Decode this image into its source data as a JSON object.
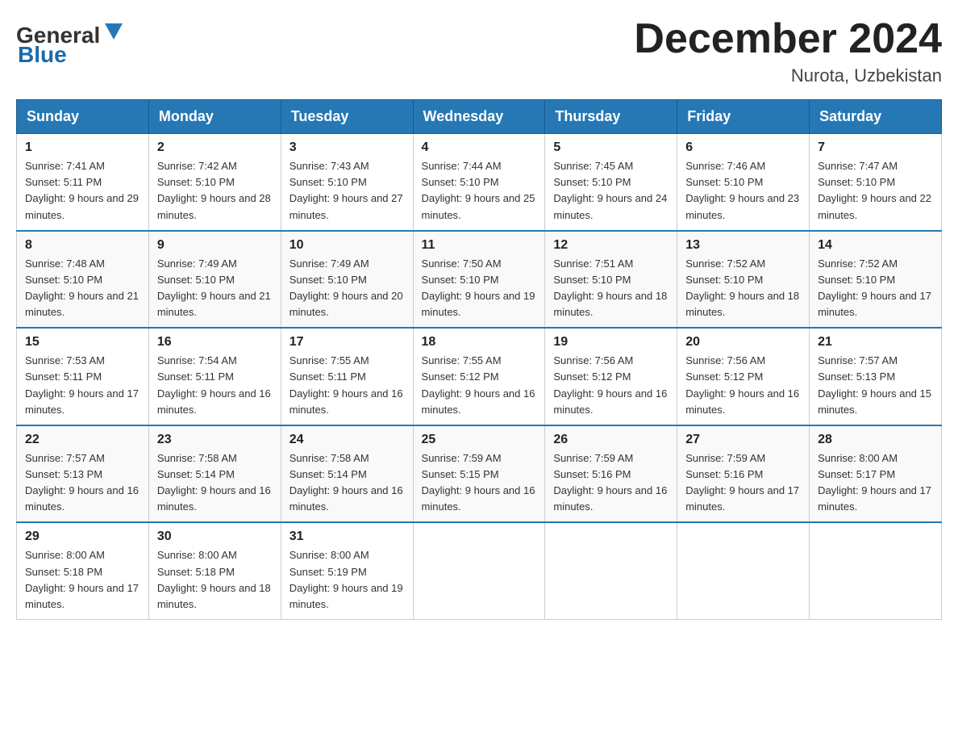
{
  "header": {
    "logo_general": "General",
    "logo_blue": "Blue",
    "month_title": "December 2024",
    "location": "Nurota, Uzbekistan"
  },
  "weekdays": [
    "Sunday",
    "Monday",
    "Tuesday",
    "Wednesday",
    "Thursday",
    "Friday",
    "Saturday"
  ],
  "weeks": [
    [
      {
        "day": "1",
        "sunrise": "7:41 AM",
        "sunset": "5:11 PM",
        "daylight": "9 hours and 29 minutes."
      },
      {
        "day": "2",
        "sunrise": "7:42 AM",
        "sunset": "5:10 PM",
        "daylight": "9 hours and 28 minutes."
      },
      {
        "day": "3",
        "sunrise": "7:43 AM",
        "sunset": "5:10 PM",
        "daylight": "9 hours and 27 minutes."
      },
      {
        "day": "4",
        "sunrise": "7:44 AM",
        "sunset": "5:10 PM",
        "daylight": "9 hours and 25 minutes."
      },
      {
        "day": "5",
        "sunrise": "7:45 AM",
        "sunset": "5:10 PM",
        "daylight": "9 hours and 24 minutes."
      },
      {
        "day": "6",
        "sunrise": "7:46 AM",
        "sunset": "5:10 PM",
        "daylight": "9 hours and 23 minutes."
      },
      {
        "day": "7",
        "sunrise": "7:47 AM",
        "sunset": "5:10 PM",
        "daylight": "9 hours and 22 minutes."
      }
    ],
    [
      {
        "day": "8",
        "sunrise": "7:48 AM",
        "sunset": "5:10 PM",
        "daylight": "9 hours and 21 minutes."
      },
      {
        "day": "9",
        "sunrise": "7:49 AM",
        "sunset": "5:10 PM",
        "daylight": "9 hours and 21 minutes."
      },
      {
        "day": "10",
        "sunrise": "7:49 AM",
        "sunset": "5:10 PM",
        "daylight": "9 hours and 20 minutes."
      },
      {
        "day": "11",
        "sunrise": "7:50 AM",
        "sunset": "5:10 PM",
        "daylight": "9 hours and 19 minutes."
      },
      {
        "day": "12",
        "sunrise": "7:51 AM",
        "sunset": "5:10 PM",
        "daylight": "9 hours and 18 minutes."
      },
      {
        "day": "13",
        "sunrise": "7:52 AM",
        "sunset": "5:10 PM",
        "daylight": "9 hours and 18 minutes."
      },
      {
        "day": "14",
        "sunrise": "7:52 AM",
        "sunset": "5:10 PM",
        "daylight": "9 hours and 17 minutes."
      }
    ],
    [
      {
        "day": "15",
        "sunrise": "7:53 AM",
        "sunset": "5:11 PM",
        "daylight": "9 hours and 17 minutes."
      },
      {
        "day": "16",
        "sunrise": "7:54 AM",
        "sunset": "5:11 PM",
        "daylight": "9 hours and 16 minutes."
      },
      {
        "day": "17",
        "sunrise": "7:55 AM",
        "sunset": "5:11 PM",
        "daylight": "9 hours and 16 minutes."
      },
      {
        "day": "18",
        "sunrise": "7:55 AM",
        "sunset": "5:12 PM",
        "daylight": "9 hours and 16 minutes."
      },
      {
        "day": "19",
        "sunrise": "7:56 AM",
        "sunset": "5:12 PM",
        "daylight": "9 hours and 16 minutes."
      },
      {
        "day": "20",
        "sunrise": "7:56 AM",
        "sunset": "5:12 PM",
        "daylight": "9 hours and 16 minutes."
      },
      {
        "day": "21",
        "sunrise": "7:57 AM",
        "sunset": "5:13 PM",
        "daylight": "9 hours and 15 minutes."
      }
    ],
    [
      {
        "day": "22",
        "sunrise": "7:57 AM",
        "sunset": "5:13 PM",
        "daylight": "9 hours and 16 minutes."
      },
      {
        "day": "23",
        "sunrise": "7:58 AM",
        "sunset": "5:14 PM",
        "daylight": "9 hours and 16 minutes."
      },
      {
        "day": "24",
        "sunrise": "7:58 AM",
        "sunset": "5:14 PM",
        "daylight": "9 hours and 16 minutes."
      },
      {
        "day": "25",
        "sunrise": "7:59 AM",
        "sunset": "5:15 PM",
        "daylight": "9 hours and 16 minutes."
      },
      {
        "day": "26",
        "sunrise": "7:59 AM",
        "sunset": "5:16 PM",
        "daylight": "9 hours and 16 minutes."
      },
      {
        "day": "27",
        "sunrise": "7:59 AM",
        "sunset": "5:16 PM",
        "daylight": "9 hours and 17 minutes."
      },
      {
        "day": "28",
        "sunrise": "8:00 AM",
        "sunset": "5:17 PM",
        "daylight": "9 hours and 17 minutes."
      }
    ],
    [
      {
        "day": "29",
        "sunrise": "8:00 AM",
        "sunset": "5:18 PM",
        "daylight": "9 hours and 17 minutes."
      },
      {
        "day": "30",
        "sunrise": "8:00 AM",
        "sunset": "5:18 PM",
        "daylight": "9 hours and 18 minutes."
      },
      {
        "day": "31",
        "sunrise": "8:00 AM",
        "sunset": "5:19 PM",
        "daylight": "9 hours and 19 minutes."
      },
      null,
      null,
      null,
      null
    ]
  ],
  "labels": {
    "sunrise": "Sunrise:",
    "sunset": "Sunset:",
    "daylight": "Daylight:"
  }
}
